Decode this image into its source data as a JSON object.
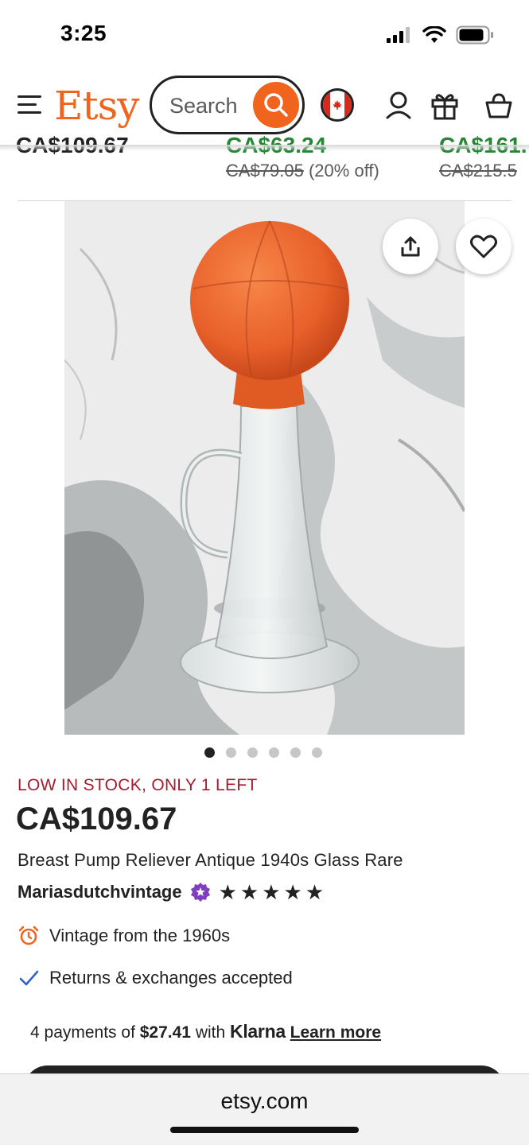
{
  "status_bar": {
    "time": "3:25",
    "icons": [
      "cellular-signal-icon",
      "wifi-icon",
      "battery-icon"
    ]
  },
  "header": {
    "logo": "Etsy",
    "search_placeholder": "Search",
    "icons": [
      "menu-icon",
      "search-icon",
      "canada-flag-icon",
      "account-icon",
      "gift-icon",
      "cart-icon"
    ],
    "brand_color": "#f1641e"
  },
  "related_strip": [
    {
      "price": "CA$109.67",
      "original": "",
      "discount": ""
    },
    {
      "price": "CA$63.24",
      "original": "CA$79.05",
      "discount": "(20% off)"
    },
    {
      "price": "CA$161.",
      "original": "CA$215.5",
      "discount": ""
    }
  ],
  "gallery": {
    "image_count": 6,
    "active_index": 0,
    "icons": [
      "share-icon",
      "heart-icon"
    ]
  },
  "listing": {
    "stock_notice": "LOW IN STOCK, ONLY 1 LEFT",
    "price": "CA$109.67",
    "title": "Breast Pump Reliever Antique 1940s Glass Rare",
    "shop_name": "Mariasdutchvintage",
    "rating_stars": 5,
    "features": [
      {
        "icon": "alarm-clock-icon",
        "text": "Vintage from the 1960s"
      },
      {
        "icon": "checkmark-icon",
        "text": "Returns & exchanges accepted"
      }
    ],
    "klarna": {
      "prefix": "4 payments of",
      "amount": "$27.41",
      "with": "with",
      "brand": "Klarna",
      "link": "Learn more"
    }
  },
  "browser": {
    "url": "etsy.com"
  },
  "colors": {
    "sale_green": "#258635",
    "stock_red": "#a61a2e",
    "star_seller_purple": "#7f3fbf"
  }
}
